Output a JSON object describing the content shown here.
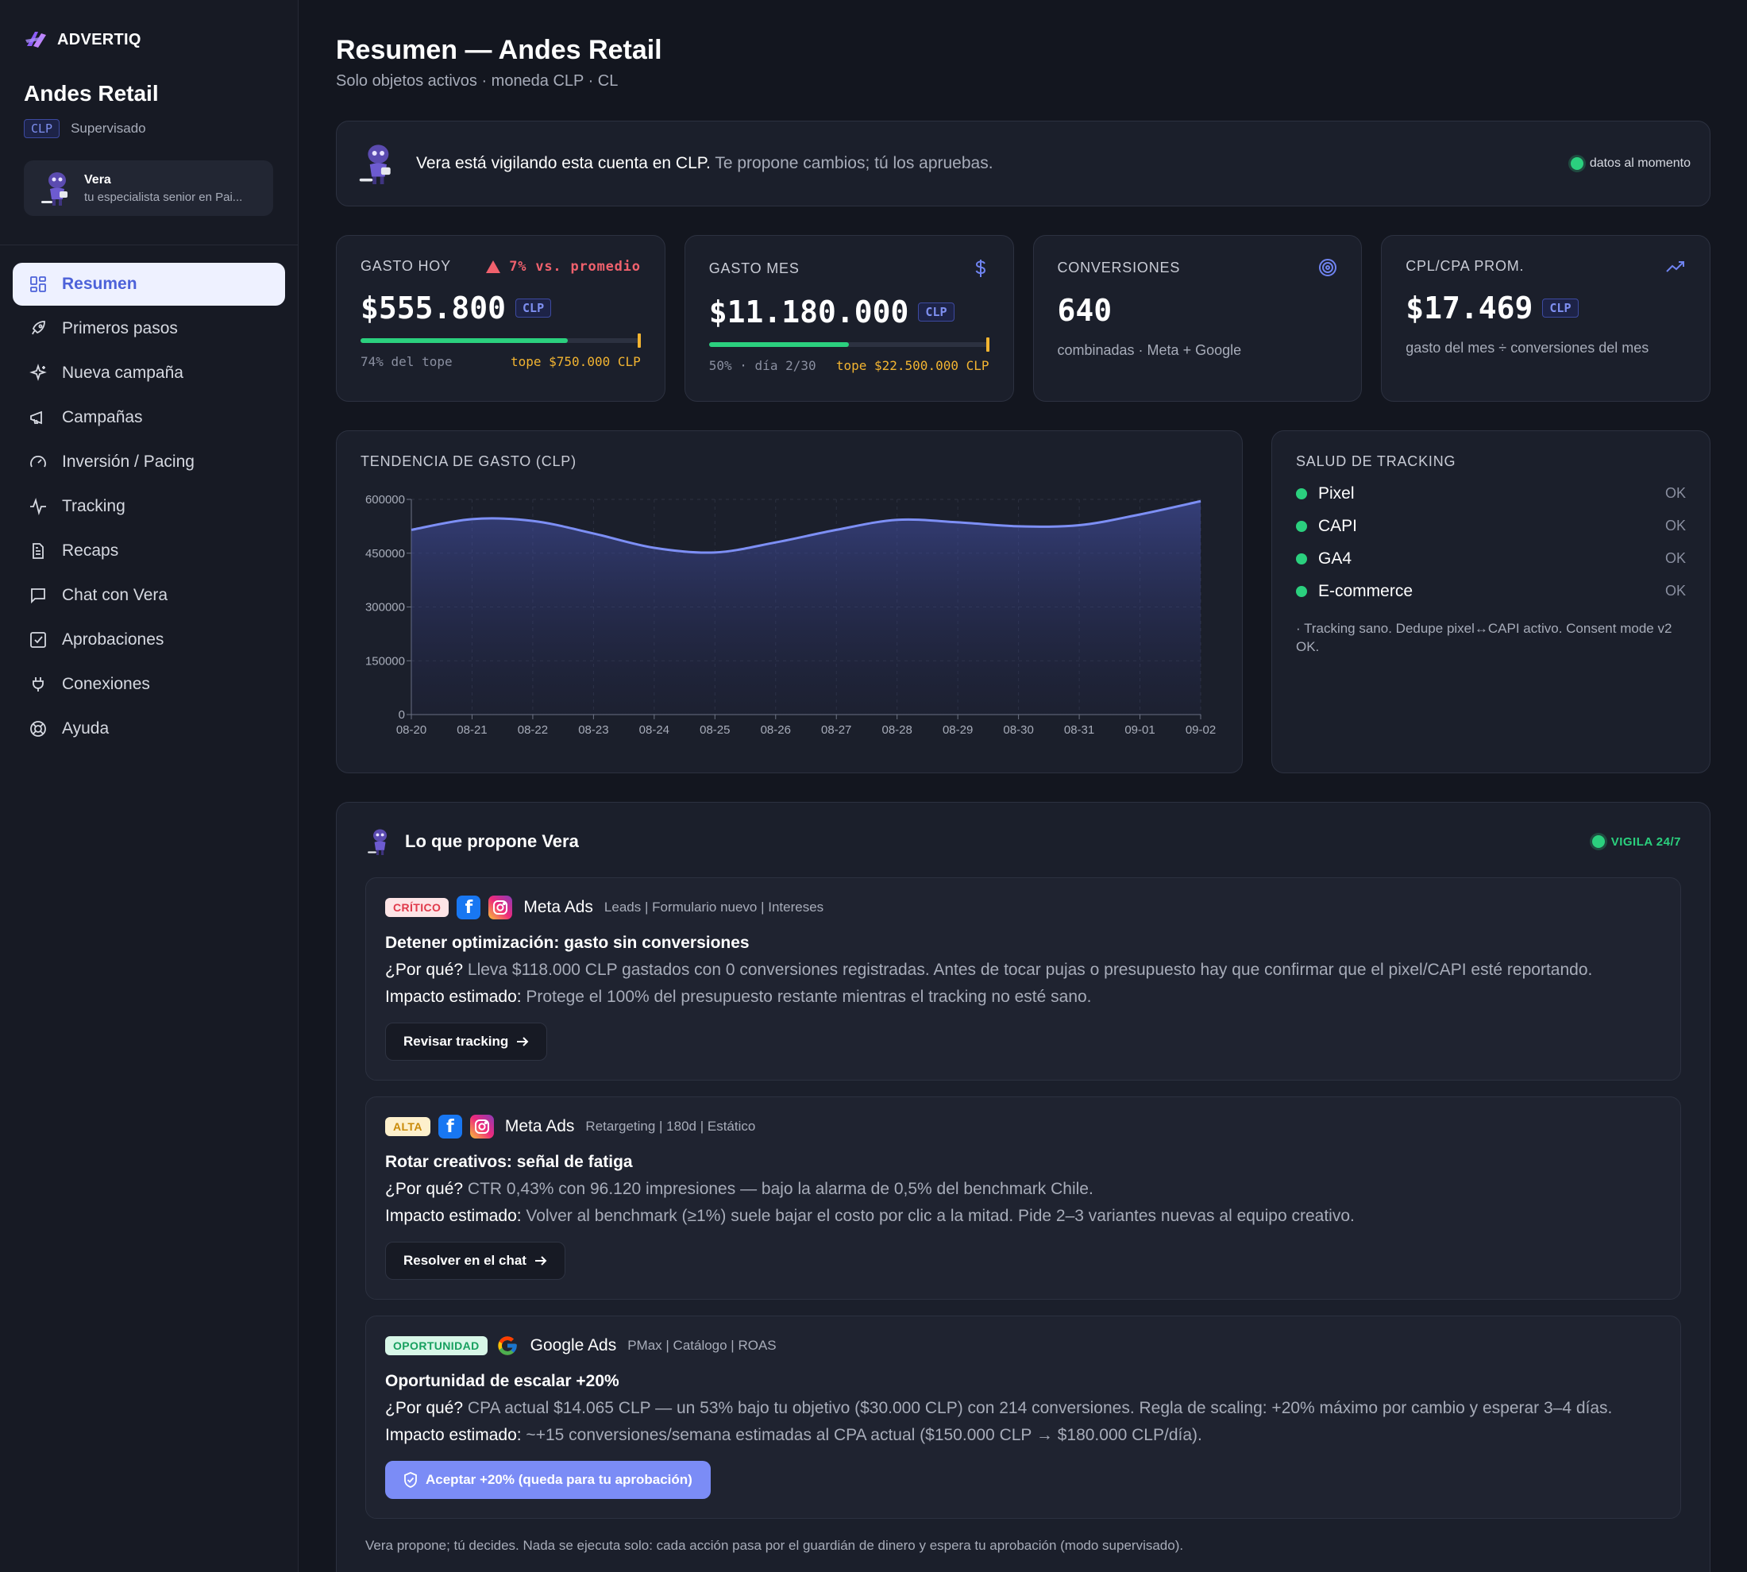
{
  "brand": {
    "name": "ADVERTIQ"
  },
  "account": {
    "name": "Andes Retail",
    "currency": "CLP",
    "mode": "Supervisado"
  },
  "vera": {
    "name": "Vera",
    "role": "tu especialista senior en Pai..."
  },
  "nav": [
    {
      "label": "Resumen",
      "icon": "grid-icon"
    },
    {
      "label": "Primeros pasos",
      "icon": "rocket-icon"
    },
    {
      "label": "Nueva campaña",
      "icon": "sparkle-icon"
    },
    {
      "label": "Campañas",
      "icon": "megaphone-icon"
    },
    {
      "label": "Inversión / Pacing",
      "icon": "gauge-icon"
    },
    {
      "label": "Tracking",
      "icon": "pulse-icon"
    },
    {
      "label": "Recaps",
      "icon": "document-icon"
    },
    {
      "label": "Chat con Vera",
      "icon": "chat-icon"
    },
    {
      "label": "Aprobaciones",
      "icon": "checkbox-icon"
    },
    {
      "label": "Conexiones",
      "icon": "plug-icon"
    },
    {
      "label": "Ayuda",
      "icon": "lifebuoy-icon"
    }
  ],
  "page": {
    "title": "Resumen — Andes Retail",
    "subtitle": "Solo objetos activos · moneda CLP · CL"
  },
  "banner": {
    "name": "Vera",
    "lead": " está vigilando esta cuenta en CLP.",
    "rest": " Te propone cambios; tú los apruebas.",
    "status": "datos al momento"
  },
  "kpis": {
    "gasto_hoy": {
      "label": "GASTO HOY",
      "alert": "7% vs. promedio",
      "value": "$555.800",
      "currency": "CLP",
      "progress": 0.74,
      "left": "74% del tope",
      "cap": "tope $750.000 CLP"
    },
    "gasto_mes": {
      "label": "GASTO MES",
      "value": "$11.180.000",
      "currency": "CLP",
      "progress": 0.5,
      "left": "50% · día 2/30",
      "cap": "tope $22.500.000 CLP"
    },
    "conversiones": {
      "label": "CONVERSIONES",
      "value": "640",
      "note": "combinadas · Meta + Google"
    },
    "cpl": {
      "label": "CPL/CPA PROM.",
      "value": "$17.469",
      "currency": "CLP",
      "note": "gasto del mes ÷ conversiones del mes"
    }
  },
  "chart_data": {
    "type": "area",
    "title": "TENDENCIA DE GASTO (CLP)",
    "x": [
      "08-20",
      "08-21",
      "08-22",
      "08-23",
      "08-24",
      "08-25",
      "08-26",
      "08-27",
      "08-28",
      "08-29",
      "08-30",
      "08-31",
      "09-01",
      "09-02"
    ],
    "values": [
      515000,
      545000,
      540000,
      505000,
      465000,
      452000,
      480000,
      515000,
      543000,
      536000,
      525000,
      528000,
      558000,
      595000
    ],
    "yticks": [
      "600000",
      "450000",
      "300000",
      "150000",
      "0"
    ],
    "ylim": [
      0,
      600000
    ],
    "grid": true,
    "line_color": "#7d8ff5"
  },
  "tracking": {
    "title": "SALUD DE TRACKING",
    "items": [
      {
        "name": "Pixel",
        "status": "OK"
      },
      {
        "name": "CAPI",
        "status": "OK"
      },
      {
        "name": "GA4",
        "status": "OK"
      },
      {
        "name": "E-commerce",
        "status": "OK"
      }
    ],
    "note": "· Tracking sano. Dedupe pixel↔CAPI activo. Consent mode v2 OK."
  },
  "proposals": {
    "title": "Lo que propone Vera",
    "badge": "VIGILA 24/7",
    "items": [
      {
        "tag": "CRÍTICO",
        "platform": "Meta Ads",
        "sub": "Leads | Formulario nuevo | Intereses",
        "title": "Detener optimización: gasto sin conversiones",
        "why_label": "¿Por qué?",
        "why": " Lleva $118.000 CLP gastados con 0 conversiones registradas. Antes de tocar pujas o presupuesto hay que confirmar que el pixel/CAPI esté reportando.",
        "impact_label": "Impacto estimado:",
        "impact": " Protege el 100% del presupuesto restante mientras el tracking no esté sano.",
        "cta": "Revisar tracking"
      },
      {
        "tag": "ALTA",
        "platform": "Meta Ads",
        "sub": "Retargeting | 180d | Estático",
        "title": "Rotar creativos: señal de fatiga",
        "why_label": "¿Por qué?",
        "why": " CTR 0,43% con 96.120 impresiones — bajo la alarma de 0,5% del benchmark Chile.",
        "impact_label": "Impacto estimado:",
        "impact": " Volver al benchmark (≥1%) suele bajar el costo por clic a la mitad. Pide 2–3 variantes nuevas al equipo creativo.",
        "cta": "Resolver en el chat"
      },
      {
        "tag": "OPORTUNIDAD",
        "platform": "Google Ads",
        "sub": "PMax | Catálogo | ROAS",
        "title": "Oportunidad de escalar +20%",
        "why_label": "¿Por qué?",
        "why": " CPA actual $14.065 CLP — un 53% bajo tu objetivo ($30.000 CLP) con 214 conversiones. Regla de scaling: +20% máximo por cambio y esperar 3–4 días.",
        "impact_label": "Impacto estimado:",
        "impact": " ~+15 conversiones/semana estimadas al CPA actual ($150.000 CLP → $180.000 CLP/día).",
        "cta": "Aceptar +20% (queda para tu aprobación)"
      }
    ],
    "footer": "Vera propone; tú decides. Nada se ejecuta solo: cada acción pasa por el guardián de dinero y espera tu aprobación (modo supervisado)."
  }
}
